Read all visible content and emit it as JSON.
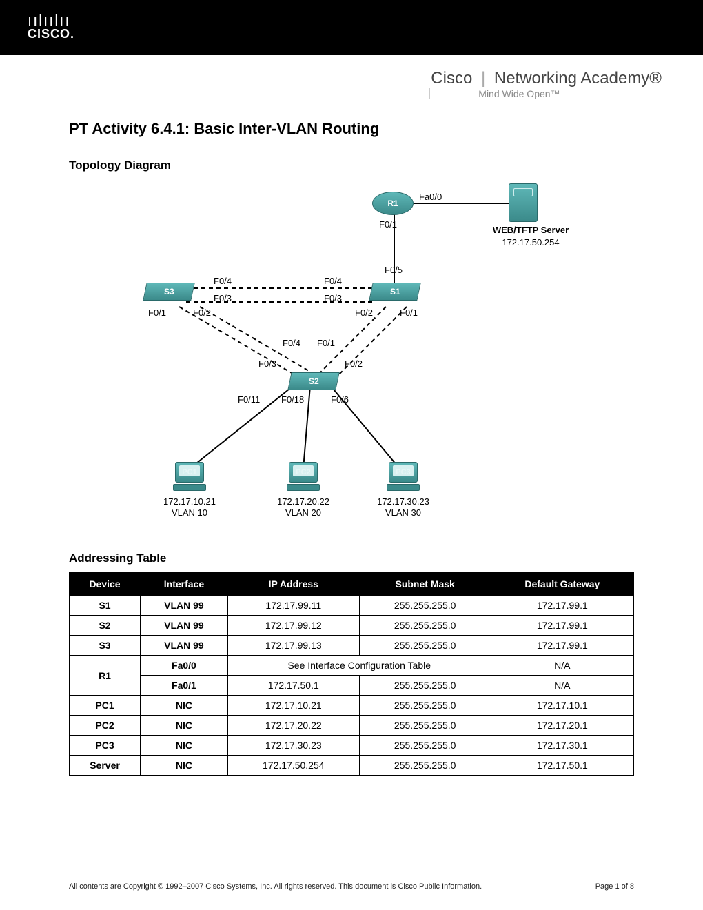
{
  "header": {
    "logo_bars": "ıılıılıı",
    "logo_word": "CISCO.",
    "academy_brand": "Cisco",
    "academy_name": "Networking Academy®",
    "academy_tagline": "Mind Wide Open™"
  },
  "title": "PT Activity 6.4.1: Basic Inter-VLAN Routing",
  "sections": {
    "topology": "Topology Diagram",
    "addressing": "Addressing Table"
  },
  "diagram": {
    "devices": {
      "R1": "R1",
      "S1": "S1",
      "S2": "S2",
      "S3": "S3",
      "PC1": "PC1",
      "PC2": "PC2",
      "PC3": "PC3",
      "server_name": "WEB/TFTP Server",
      "server_ip": "172.17.50.254"
    },
    "ports": {
      "r1_fa00": "Fa0/0",
      "r1_f01": "F0/1",
      "s1_f05": "F0/5",
      "s3_f04": "F0/4",
      "s1_f04": "F0/4",
      "s3_f03": "F0/3",
      "s1_f03": "F0/3",
      "s3_f01": "F0/1",
      "s3_f02": "F0/2",
      "s1_f02": "F0/2",
      "s1_f01": "F0/1",
      "mid_f04": "F0/4",
      "mid_f01": "F0/1",
      "s2_f03": "F0/3",
      "s2_f02": "F0/2",
      "s2_f011": "F0/11",
      "s2_f018": "F0/18",
      "s2_f06": "F0/6"
    },
    "pc_info": {
      "pc1_ip": "172.17.10.21",
      "pc1_vlan": "VLAN 10",
      "pc2_ip": "172.17.20.22",
      "pc2_vlan": "VLAN 20",
      "pc3_ip": "172.17.30.23",
      "pc3_vlan": "VLAN 30"
    }
  },
  "table": {
    "headers": [
      "Device",
      "Interface",
      "IP Address",
      "Subnet Mask",
      "Default Gateway"
    ],
    "rows": [
      {
        "device": "S1",
        "iface": "VLAN 99",
        "ip": "172.17.99.11",
        "mask": "255.255.255.0",
        "gw": "172.17.99.1"
      },
      {
        "device": "S2",
        "iface": "VLAN 99",
        "ip": "172.17.99.12",
        "mask": "255.255.255.0",
        "gw": "172.17.99.1"
      },
      {
        "device": "S3",
        "iface": "VLAN 99",
        "ip": "172.17.99.13",
        "mask": "255.255.255.0",
        "gw": "172.17.99.1"
      }
    ],
    "r1": {
      "device": "R1",
      "r1_fa00_iface": "Fa0/0",
      "r1_fa00_note": "See Interface Configuration Table",
      "r1_fa00_gw": "N/A",
      "r1_fa01_iface": "Fa0/1",
      "r1_fa01_ip": "172.17.50.1",
      "r1_fa01_mask": "255.255.255.0",
      "r1_fa01_gw": "N/A"
    },
    "rows2": [
      {
        "device": "PC1",
        "iface": "NIC",
        "ip": "172.17.10.21",
        "mask": "255.255.255.0",
        "gw": "172.17.10.1"
      },
      {
        "device": "PC2",
        "iface": "NIC",
        "ip": "172.17.20.22",
        "mask": "255.255.255.0",
        "gw": "172.17.20.1"
      },
      {
        "device": "PC3",
        "iface": "NIC",
        "ip": "172.17.30.23",
        "mask": "255.255.255.0",
        "gw": "172.17.30.1"
      },
      {
        "device": "Server",
        "iface": "NIC",
        "ip": "172.17.50.254",
        "mask": "255.255.255.0",
        "gw": "172.17.50.1"
      }
    ]
  },
  "footer": {
    "copyright": "All contents are Copyright © 1992–2007 Cisco Systems, Inc. All rights reserved. This document is Cisco Public Information.",
    "page": "Page 1 of 8"
  }
}
